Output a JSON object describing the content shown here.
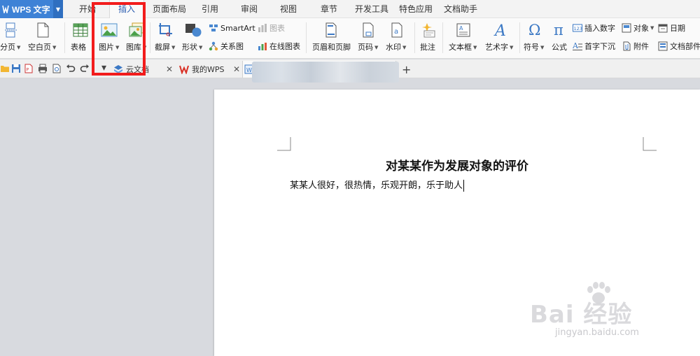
{
  "app": {
    "title": "WPS 文字"
  },
  "menu": {
    "tabs": [
      "开始",
      "插入",
      "页面布局",
      "引用",
      "审阅",
      "视图",
      "章节",
      "开发工具",
      "特色应用",
      "文档助手"
    ],
    "active_index": 1
  },
  "ribbon": {
    "page_break": "分页",
    "blank_page": "空白页",
    "table": "表格",
    "picture": "图片",
    "gallery": "图库",
    "screenshot": "截屏",
    "shapes": "形状",
    "smartart": "SmartArt",
    "chart": "图表",
    "relation_chart": "关系图",
    "online_chart": "在线图表",
    "header_footer": "页眉和页脚",
    "page_number": "页码",
    "watermark": "水印",
    "comment": "批注",
    "textbox": "文本框",
    "wordart": "艺术字",
    "symbol": "符号",
    "formula": "公式",
    "insert_number": "插入数字",
    "object": "对象",
    "date": "日期",
    "drop_cap": "首字下沉",
    "attachment": "附件",
    "doc_parts": "文档部件"
  },
  "doc_tabs": [
    {
      "label": "云文档"
    },
    {
      "label": "我的WPS"
    }
  ],
  "document": {
    "title": "对某某作为发展对象的评价",
    "body": "某某人很好，很热情，乐观开朗，乐于助人"
  },
  "watermark": {
    "brand": "Bai 经验",
    "url": "jingyan.baidu.com"
  },
  "colors": {
    "accent": "#3e82d6",
    "highlight": "#f21c1c",
    "canvas": "#d8dadf"
  }
}
